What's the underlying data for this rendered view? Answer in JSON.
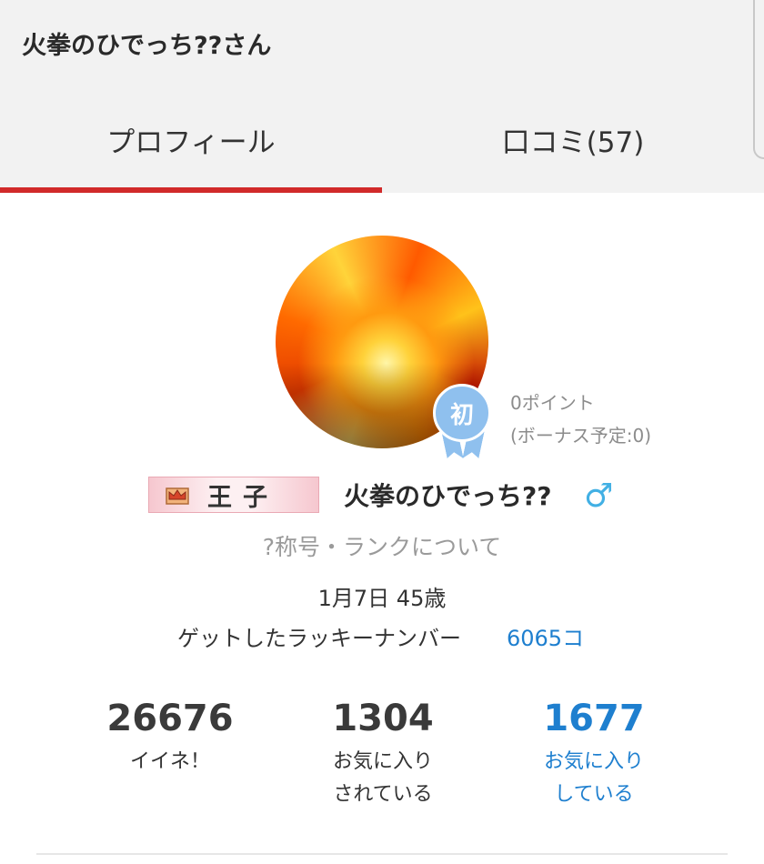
{
  "header": {
    "title": "火拳のひでっち??さん"
  },
  "tabs": [
    {
      "label": "プロフィール",
      "active": true
    },
    {
      "label": "口コミ(57)",
      "active": false
    }
  ],
  "profile": {
    "avatar": "flame-image",
    "badge": "初",
    "points": "0ポイント",
    "bonus": "(ボーナス予定:0)",
    "rank": {
      "icon": "crown-icon",
      "label": "王子"
    },
    "name": "火拳のひでっち??",
    "gender_symbol": "♂",
    "rank_link": "?称号・ランクについて",
    "birthday": "1月7日 45歳",
    "lucky_label": "ゲットしたラッキーナンバー",
    "lucky_count": "6065コ"
  },
  "stats": [
    {
      "value": "26676",
      "label_line1": "イイネ！",
      "label_line2": ""
    },
    {
      "value": "1304",
      "label_line1": "お気に入り",
      "label_line2": "されている"
    },
    {
      "value": "1677",
      "label_line1": "お気に入り",
      "label_line2": "している"
    }
  ],
  "colors": {
    "accent": "#d12a2a",
    "link": "#1e7fcf",
    "badge": "#8fc0ee",
    "gender": "#42b0e4"
  }
}
